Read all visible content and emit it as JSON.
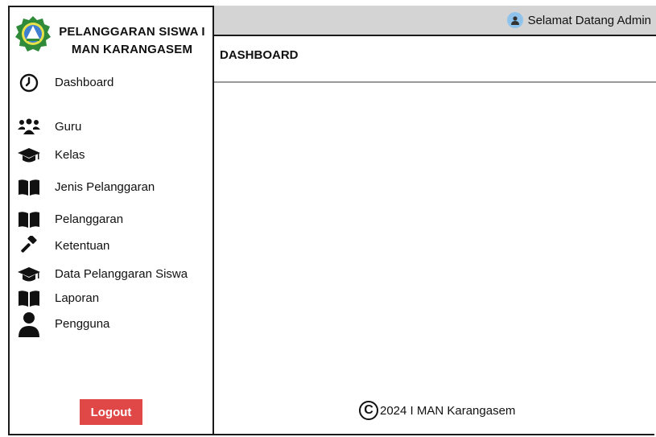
{
  "brand": {
    "line1": "PELANGGARAN SISWA I",
    "line2": "MAN KARANGASEM",
    "logo_icon": "school-emblem-icon"
  },
  "sidebar": {
    "items": [
      {
        "label": "Dashboard",
        "icon": "clock-icon"
      },
      {
        "label": "Guru",
        "icon": "users-icon"
      },
      {
        "label": "Kelas",
        "icon": "graduation-cap-icon"
      },
      {
        "label": "Jenis Pelanggaran",
        "icon": "book-icon"
      },
      {
        "label": "Pelanggaran",
        "icon": "book-icon"
      },
      {
        "label": "Ketentuan",
        "icon": "gavel-icon"
      },
      {
        "label": "Data Pelanggaran Siswa",
        "icon": "graduation-cap-icon"
      },
      {
        "label": "Laporan",
        "icon": "book-icon"
      },
      {
        "label": "Pengguna",
        "icon": "user-icon"
      }
    ],
    "logout_label": "Logout"
  },
  "topbar": {
    "welcome": "Selamat Datang Admin",
    "icon": "user-circle-icon"
  },
  "main": {
    "title": "DASHBOARD"
  },
  "footer": {
    "text": "2024 I MAN Karangasem",
    "icon": "copyright-icon"
  },
  "colors": {
    "topbar_bg": "#d4d4d4",
    "logout_bg": "#e04848",
    "divider": "#9a9a9a",
    "logo_green": "#2f8a3a",
    "user_icon_bg": "#8fc3ec"
  }
}
